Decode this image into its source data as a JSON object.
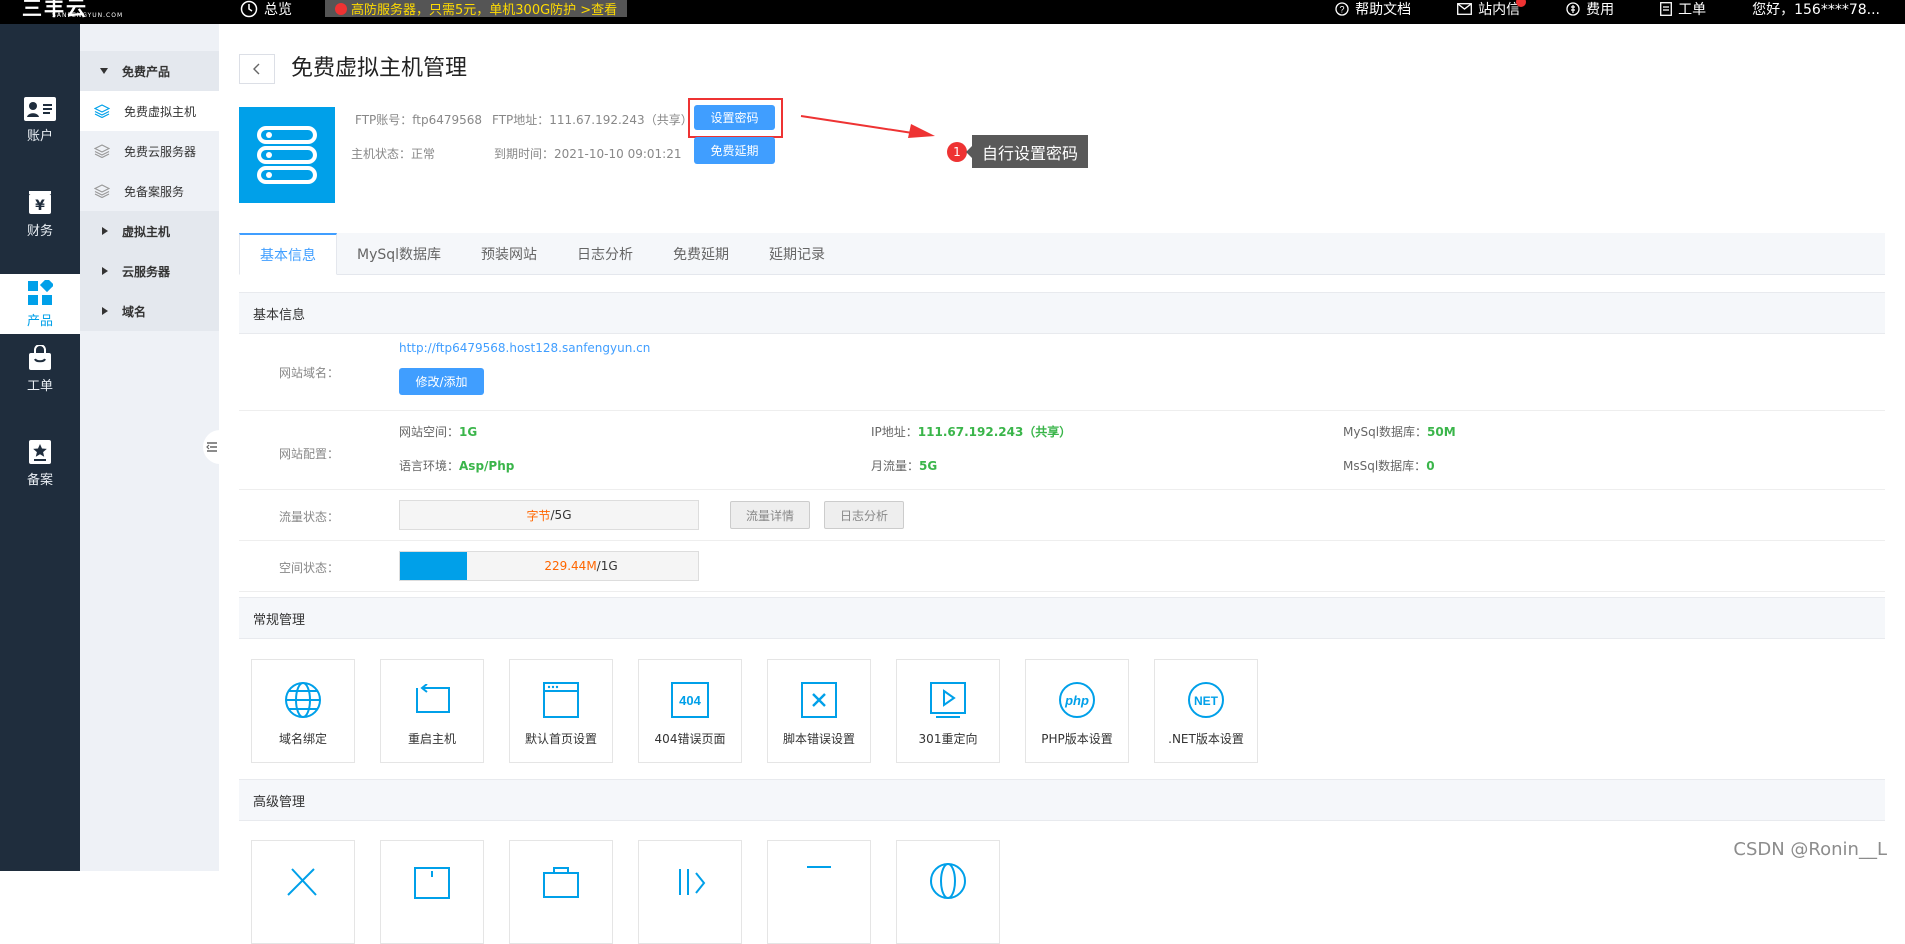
{
  "topbar": {
    "brand": "三丰云",
    "brand_sub": "SANFENGYUN.COM",
    "overview": "总览",
    "promo": "高防服务器，只需5元，单机300G防护 >查看",
    "help": "帮助文档",
    "messages": "站内信",
    "billing": "费用",
    "tickets": "工单",
    "greeting": "您好，156****78..."
  },
  "rail": [
    {
      "label": "账户",
      "icon": "user-card-icon"
    },
    {
      "label": "财务",
      "icon": "yen-bag-icon"
    },
    {
      "label": "产品",
      "icon": "grid-icon"
    },
    {
      "label": "工单",
      "icon": "bag-icon"
    },
    {
      "label": "备案",
      "icon": "star-badge-icon"
    }
  ],
  "subnav": {
    "free_cat": "免费产品",
    "free_host": "免费虚拟主机",
    "free_cloud": "免费云服务器",
    "free_record": "免备案服务",
    "vhost": "虚拟主机",
    "cloud": "云服务器",
    "domain": "域名"
  },
  "header": {
    "title": "免费虚拟主机管理",
    "ftp_account_label": "FTP账号：",
    "ftp_account": "ftp6479568",
    "ftp_addr_label": "FTP地址：",
    "ftp_addr": "111.67.192.243（共享）",
    "set_password": "设置密码",
    "status_label": "主机状态：",
    "status": "正常",
    "expire_label": "到期时间：",
    "expire": "2021-10-10 09:01:21",
    "extend": "免费延期",
    "tip_num": "1",
    "tip_text": "自行设置密码"
  },
  "tabs": [
    "基本信息",
    "MySql数据库",
    "预装网站",
    "日志分析",
    "免费延期",
    "延期记录"
  ],
  "basic": {
    "section": "基本信息",
    "site_domain_label": "网站域名：",
    "site_url": "http://ftp6479568.host128.sanfengyun.cn",
    "edit_add": "修改/添加",
    "site_config_label": "网站配置：",
    "space_label": "网站空间：",
    "space": "1G",
    "ip_label": "IP地址：",
    "ip": "111.67.192.243（共享）",
    "mysql_label": "MySql数据库：",
    "mysql": "50M",
    "lang_label": "语言环境：",
    "lang": "Asp/Php",
    "traffic_label": "月流量：",
    "traffic": "5G",
    "mssql_label": "MsSql数据库：",
    "mssql": "0",
    "flow_status_label": "流量状态：",
    "flow_used": "字节",
    "flow_total": "/5G",
    "flow_detail": "流量详情",
    "log_analysis": "日志分析",
    "space_status_label": "空间状态：",
    "space_used": "229.44M",
    "space_total": "/1G",
    "space_fraction": 0.224
  },
  "general": {
    "section": "常规管理",
    "cards": [
      {
        "label": "域名绑定",
        "icon": "globe-icon"
      },
      {
        "label": "重启主机",
        "icon": "restart-icon"
      },
      {
        "label": "默认首页设置",
        "icon": "browser-window-icon"
      },
      {
        "label": "404错误页面",
        "icon": "404-icon"
      },
      {
        "label": "脚本错误设置",
        "icon": "error-x-icon"
      },
      {
        "label": "301重定向",
        "icon": "play-redirect-icon"
      },
      {
        "label": "PHP版本设置",
        "icon": "php-icon"
      },
      {
        "label": ".NET版本设置",
        "icon": "net-icon"
      }
    ]
  },
  "advanced": {
    "section": "高级管理"
  },
  "watermark": "CSDN @Ronin__L"
}
